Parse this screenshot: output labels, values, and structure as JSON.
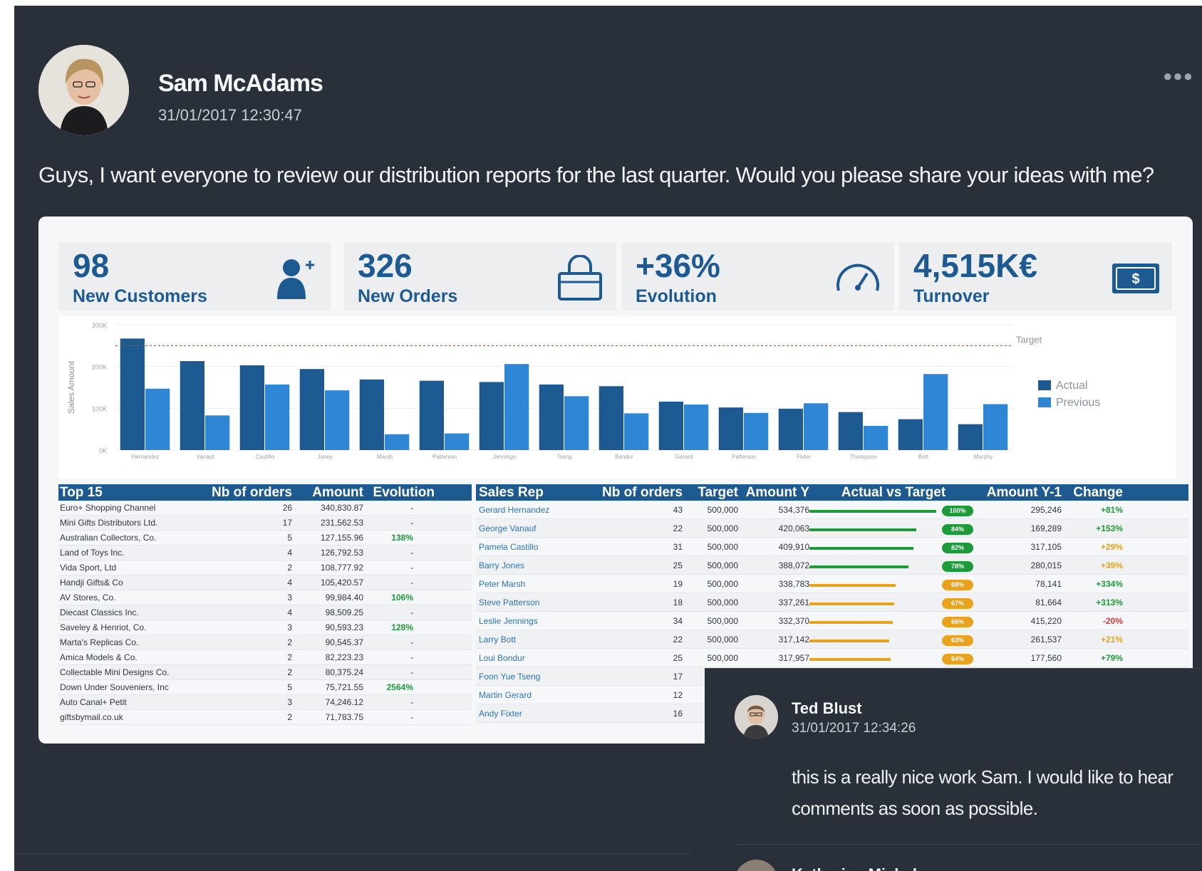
{
  "post": {
    "author": "Sam McAdams",
    "timestamp": "31/01/2017 12:30:47",
    "more_icon": "ellipsis-icon",
    "text": "Guys, I want everyone to review our distribution reports for the last quarter. Would you please share your ideas with me?"
  },
  "kpis": [
    {
      "value": "98",
      "label": "New Customers",
      "icon": "user-plus-icon"
    },
    {
      "value": "326",
      "label": "New Orders",
      "icon": "shopping-bag-icon"
    },
    {
      "value": "+36%",
      "label": "Evolution",
      "icon": "speedometer-icon"
    },
    {
      "value": "4,515K€",
      "label": "Turnover",
      "icon": "money-icon"
    }
  ],
  "chart_data": {
    "type": "bar",
    "ylabel": "Sales Amount",
    "yticks": [
      "300K",
      "200K",
      "100K",
      "0K"
    ],
    "ylim": [
      0,
      300
    ],
    "target_label": "Target",
    "target_value": 250,
    "categories": [
      "Hernandez",
      "Vanauf",
      "Castillo",
      "Jones",
      "Marsh",
      "Patterson",
      "Jennings",
      "Tseng",
      "Bondur",
      "Gerard",
      "Patterson",
      "Fixter",
      "Thompson",
      "Bott",
      "Murphy"
    ],
    "series": [
      {
        "name": "Actual",
        "color": "#1e5a92",
        "values": [
          267,
          213,
          203,
          194,
          169,
          166,
          163,
          157,
          153,
          116,
          102,
          99,
          91,
          74,
          62
        ]
      },
      {
        "name": "Previous",
        "color": "#2f86d4",
        "values": [
          147,
          83,
          157,
          143,
          38,
          40,
          206,
          129,
          88,
          109,
          89,
          112,
          58,
          182,
          110
        ]
      }
    ],
    "legend": "right"
  },
  "top15": {
    "title": "Top 15",
    "headers": [
      "Top 15",
      "Nb of orders",
      "Amount",
      "Evolution"
    ],
    "rows": [
      [
        "Euro+ Shopping Channel",
        "26",
        "340,830.87",
        "-"
      ],
      [
        "Mini Gifts Distributors Ltd.",
        "17",
        "231,562.53",
        "-"
      ],
      [
        "Australian Collectors, Co.",
        "5",
        "127,155.96",
        "138%"
      ],
      [
        "Land of Toys Inc.",
        "4",
        "126,792.53",
        "-"
      ],
      [
        "Vida Sport, Ltd",
        "2",
        "108,777.92",
        "-"
      ],
      [
        "Handji Gifts& Co",
        "4",
        "105,420.57",
        "-"
      ],
      [
        "AV Stores, Co.",
        "3",
        "99,984.40",
        "106%"
      ],
      [
        "Diecast Classics Inc.",
        "4",
        "98,509.25",
        "-"
      ],
      [
        "Saveley & Henriot, Co.",
        "3",
        "90,593.23",
        "128%"
      ],
      [
        "Marta's Replicas Co.",
        "2",
        "90,545.37",
        "-"
      ],
      [
        "Amica Models & Co.",
        "2",
        "82,223.23",
        "-"
      ],
      [
        "Collectable Mini Designs Co.",
        "2",
        "80,375.24",
        "-"
      ],
      [
        "Down Under Souveniers, Inc",
        "5",
        "75,721.55",
        "2564%"
      ],
      [
        "Auto Canal+ Petit",
        "3",
        "74,246.12",
        "-"
      ],
      [
        "giftsbymail.co.uk",
        "2",
        "71,783.75",
        "-"
      ]
    ]
  },
  "sales": {
    "headers": [
      "Sales Rep",
      "Nb of orders",
      "Target",
      "Amount Y",
      "Actual vs Target",
      "Amount Y-1",
      "Change"
    ],
    "rows": [
      {
        "rep": "Gerard Hernandez",
        "orders": "43",
        "target": "500,000",
        "amount": "534,376",
        "pct": 100,
        "pct_label": "100%",
        "prev": "295,246",
        "change": "+81%",
        "level": "high"
      },
      {
        "rep": "George Vanauf",
        "orders": "22",
        "target": "500,000",
        "amount": "420,063",
        "pct": 84,
        "pct_label": "84%",
        "prev": "169,289",
        "change": "+153%",
        "level": "high"
      },
      {
        "rep": "Pamela Castillo",
        "orders": "31",
        "target": "500,000",
        "amount": "409,910",
        "pct": 82,
        "pct_label": "82%",
        "prev": "317,105",
        "change": "+29%",
        "level": "high"
      },
      {
        "rep": "Barry Jones",
        "orders": "25",
        "target": "500,000",
        "amount": "388,072",
        "pct": 78,
        "pct_label": "78%",
        "prev": "280,015",
        "change": "+39%",
        "level": "high"
      },
      {
        "rep": "Peter Marsh",
        "orders": "19",
        "target": "500,000",
        "amount": "338,783",
        "pct": 68,
        "pct_label": "68%",
        "prev": "78,141",
        "change": "+334%",
        "level": "mid"
      },
      {
        "rep": "Steve Patterson",
        "orders": "18",
        "target": "500,000",
        "amount": "337,261",
        "pct": 67,
        "pct_label": "67%",
        "prev": "81,664",
        "change": "+313%",
        "level": "mid"
      },
      {
        "rep": "Leslie Jennings",
        "orders": "34",
        "target": "500,000",
        "amount": "332,370",
        "pct": 66,
        "pct_label": "66%",
        "prev": "415,220",
        "change": "-20%",
        "level": "mid"
      },
      {
        "rep": "Larry Bott",
        "orders": "22",
        "target": "500,000",
        "amount": "317,142",
        "pct": 63,
        "pct_label": "63%",
        "prev": "261,537",
        "change": "+21%",
        "level": "mid"
      },
      {
        "rep": "Loui Bondur",
        "orders": "25",
        "target": "500,000",
        "amount": "317,957",
        "pct": 64,
        "pct_label": "64%",
        "prev": "177,560",
        "change": "+79%",
        "level": "mid"
      },
      {
        "rep": "Foon Yue Tseng",
        "orders": "17",
        "target": "",
        "amount": "",
        "pct": 0,
        "pct_label": "",
        "prev": "",
        "change": "",
        "level": "none"
      },
      {
        "rep": "Martin Gerard",
        "orders": "12",
        "target": "",
        "amount": "",
        "pct": 0,
        "pct_label": "",
        "prev": "",
        "change": "",
        "level": "none"
      },
      {
        "rep": "Andy Fixter",
        "orders": "16",
        "target": "",
        "amount": "",
        "pct": 0,
        "pct_label": "",
        "prev": "",
        "change": "",
        "level": "none"
      }
    ]
  },
  "comments": [
    {
      "author": "Ted Blust",
      "timestamp": "31/01/2017 12:34:26",
      "text": "this is a really nice work Sam. I would like to hear comments as soon as possible."
    },
    {
      "author": "Katherine Michel"
    }
  ],
  "colors": {
    "background": "#2a3039",
    "accent": "#1e5a92",
    "accent_light": "#2f86d4",
    "good": "#1f9a3b",
    "warn": "#e8a21d",
    "bad": "#d9363e"
  }
}
